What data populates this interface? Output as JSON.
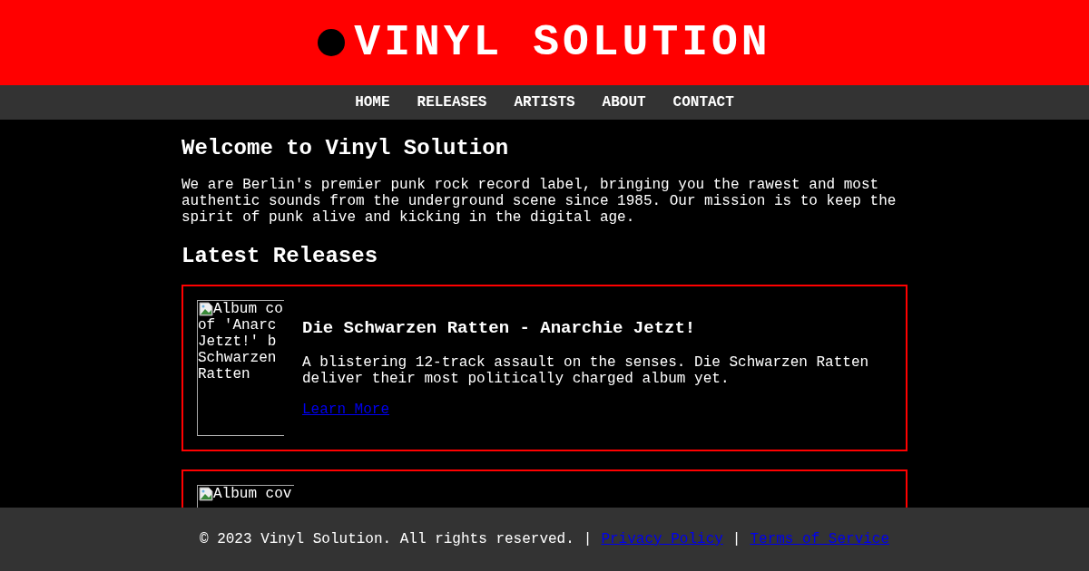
{
  "header": {
    "title": "VINYL SOLUTION"
  },
  "nav": [
    {
      "label": "HOME"
    },
    {
      "label": "RELEASES"
    },
    {
      "label": "ARTISTS"
    },
    {
      "label": "ABOUT"
    },
    {
      "label": "CONTACT"
    }
  ],
  "welcome": {
    "heading": "Welcome to Vinyl Solution",
    "text": "We are Berlin's premier punk rock record label, bringing you the rawest and most authentic sounds from the underground scene since 1985. Our mission is to keep the spirit of punk alive and kicking in the digital age."
  },
  "releases": {
    "heading": "Latest Releases",
    "items": [
      {
        "cover_alt_lines": [
          "Album co",
          "of 'Anarc",
          "Jetzt!' b",
          "Schwarzen",
          "Ratten"
        ],
        "title": "Die Schwarzen Ratten - Anarchie Jetzt!",
        "description": "A blistering 12-track assault on the senses. Die Schwarzen Ratten deliver their most politically charged album yet.",
        "link": "Learn More"
      },
      {
        "cover_alt_lines": [
          "Album cov"
        ]
      }
    ]
  },
  "footer": {
    "copyright": "© 2023 Vinyl Solution. All rights reserved.",
    "separators": [
      "|",
      "|"
    ],
    "links": [
      "Privacy Policy",
      "Terms of Service"
    ]
  }
}
